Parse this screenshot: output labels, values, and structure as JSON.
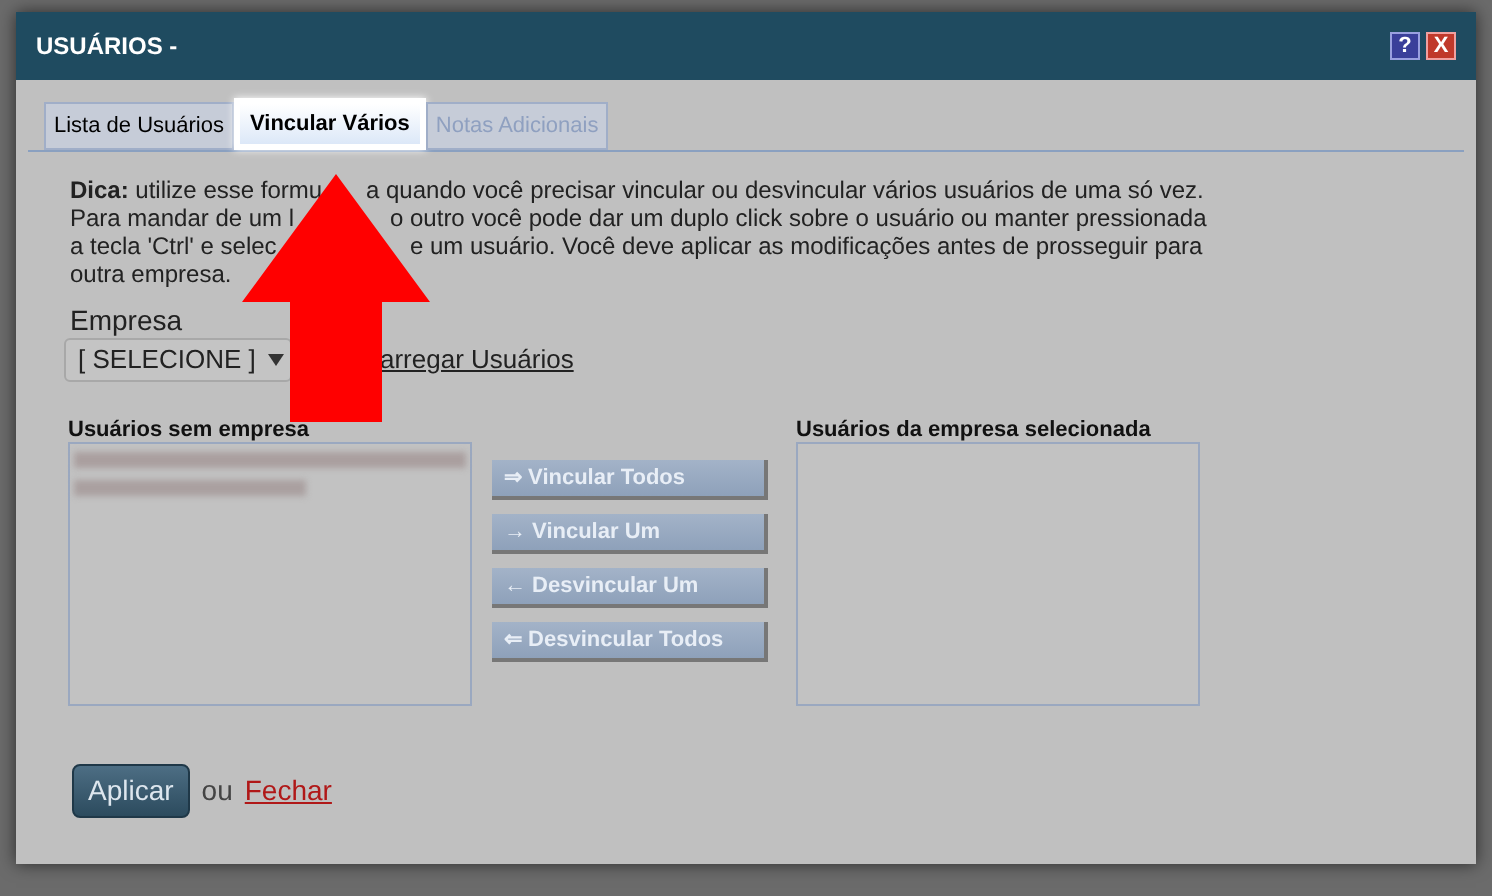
{
  "window": {
    "title": "USUÁRIOS -",
    "help": "?",
    "close": "X"
  },
  "tabs": [
    {
      "label": "Lista de Usuários",
      "selected": false,
      "disabled": false
    },
    {
      "label": "Vincular Vários",
      "selected": true,
      "disabled": false
    },
    {
      "label": "Notas Adicionais",
      "selected": false,
      "disabled": true
    }
  ],
  "tip_lines": [
    {
      "left": "**Dica:** utilize esse formu",
      "right": "a quando você precisar vincular ou desvincular vários usuários de uma só vez."
    },
    {
      "left": "Para mandar de um l",
      "right": "o outro você pode dar um duplo click sobre o usuário ou manter pressionada"
    },
    {
      "left": "a tecla 'Ctrl' e selec",
      "right": "e um usuário. Você deve aplicar as modificações antes de prosseguir para"
    },
    {
      "left": "outra empresa."
    }
  ],
  "empresa": {
    "label": "Empresa",
    "value": "[ SELECIONE ]",
    "load_link": "arregar Usuários"
  },
  "left_list": {
    "title": "Usuários sem empresa"
  },
  "move_buttons": [
    {
      "label": "⇒ Vincular Todos",
      "disabled": true
    },
    {
      "label": "→ Vincular Um",
      "disabled": true
    },
    {
      "label": "← Desvincular Um",
      "disabled": true
    },
    {
      "label": "⇐ Desvincular Todos",
      "disabled": true
    }
  ],
  "right_list": {
    "title": "Usuários da empresa selecionada"
  },
  "footer": {
    "apply": "Aplicar",
    "or": "ou",
    "close_link": "Fechar"
  }
}
